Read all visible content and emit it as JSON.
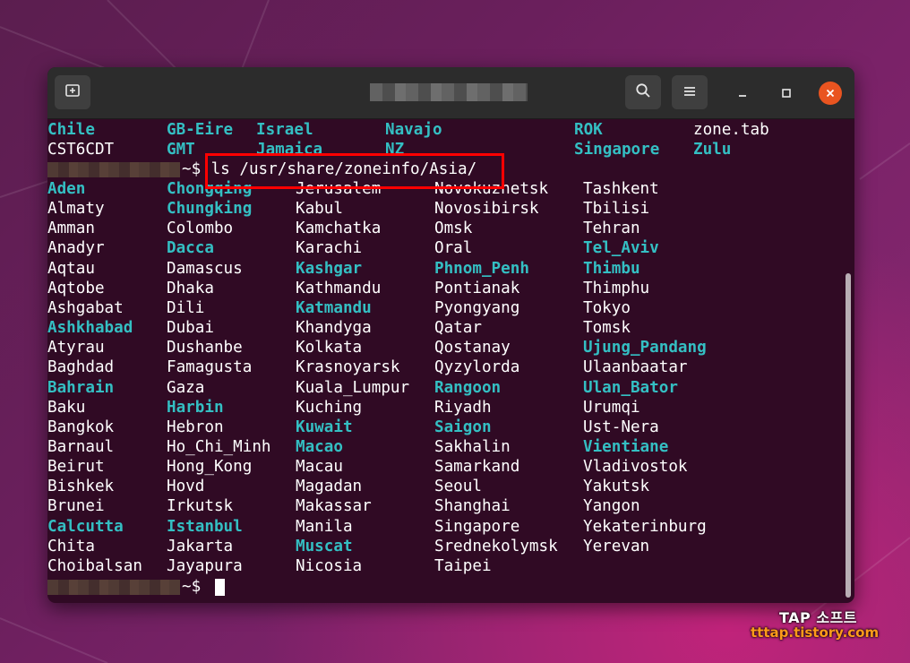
{
  "window": {
    "title_redacted": true,
    "buttons": {
      "new_tab": "new-tab",
      "search": "search",
      "menu": "menu",
      "minimize": "–",
      "maximize": "□",
      "close": "×"
    }
  },
  "colors": {
    "dir": "#34bfc3",
    "file": "#ffffff",
    "bg": "#300a24",
    "close": "#e95420",
    "highlight": "#ff0000",
    "watermark_url": "#ff9b1a"
  },
  "terminal": {
    "top_partial": [
      [
        [
          "Chile",
          "dir"
        ],
        [
          "GB-Eire",
          "dir"
        ],
        [
          "Israel",
          "dir"
        ],
        [
          "Navajo",
          "dir"
        ],
        [
          "ROK",
          "dir"
        ],
        [
          "zone.tab",
          "file"
        ]
      ],
      [
        [
          "CST6CDT",
          "file"
        ],
        [
          "GMT",
          "dir"
        ],
        [
          "Jamaica",
          "dir"
        ],
        [
          "NZ",
          "dir"
        ],
        [
          "Singapore",
          "dir"
        ],
        [
          "Zulu",
          "dir"
        ]
      ]
    ],
    "prompt_suffix": "~$",
    "command": " ls /usr/share/zoneinfo/Asia/",
    "listing": [
      [
        [
          "Aden",
          "dir"
        ],
        [
          "Chongqing",
          "dir"
        ],
        [
          "Jerusalem",
          "file"
        ],
        [
          "Novokuznetsk",
          "file"
        ],
        [
          "Tashkent",
          "file"
        ]
      ],
      [
        [
          "Almaty",
          "file"
        ],
        [
          "Chungking",
          "dir"
        ],
        [
          "Kabul",
          "file"
        ],
        [
          "Novosibirsk",
          "file"
        ],
        [
          "Tbilisi",
          "file"
        ]
      ],
      [
        [
          "Amman",
          "file"
        ],
        [
          "Colombo",
          "file"
        ],
        [
          "Kamchatka",
          "file"
        ],
        [
          "Omsk",
          "file"
        ],
        [
          "Tehran",
          "file"
        ]
      ],
      [
        [
          "Anadyr",
          "file"
        ],
        [
          "Dacca",
          "dir"
        ],
        [
          "Karachi",
          "file"
        ],
        [
          "Oral",
          "file"
        ],
        [
          "Tel_Aviv",
          "dir"
        ]
      ],
      [
        [
          "Aqtau",
          "file"
        ],
        [
          "Damascus",
          "file"
        ],
        [
          "Kashgar",
          "dir"
        ],
        [
          "Phnom_Penh",
          "dir"
        ],
        [
          "Thimbu",
          "dir"
        ]
      ],
      [
        [
          "Aqtobe",
          "file"
        ],
        [
          "Dhaka",
          "file"
        ],
        [
          "Kathmandu",
          "file"
        ],
        [
          "Pontianak",
          "file"
        ],
        [
          "Thimphu",
          "file"
        ]
      ],
      [
        [
          "Ashgabat",
          "file"
        ],
        [
          "Dili",
          "file"
        ],
        [
          "Katmandu",
          "dir"
        ],
        [
          "Pyongyang",
          "file"
        ],
        [
          "Tokyo",
          "file"
        ]
      ],
      [
        [
          "Ashkhabad",
          "dir"
        ],
        [
          "Dubai",
          "file"
        ],
        [
          "Khandyga",
          "file"
        ],
        [
          "Qatar",
          "file"
        ],
        [
          "Tomsk",
          "file"
        ]
      ],
      [
        [
          "Atyrau",
          "file"
        ],
        [
          "Dushanbe",
          "file"
        ],
        [
          "Kolkata",
          "file"
        ],
        [
          "Qostanay",
          "file"
        ],
        [
          "Ujung_Pandang",
          "dir"
        ]
      ],
      [
        [
          "Baghdad",
          "file"
        ],
        [
          "Famagusta",
          "file"
        ],
        [
          "Krasnoyarsk",
          "file"
        ],
        [
          "Qyzylorda",
          "file"
        ],
        [
          "Ulaanbaatar",
          "file"
        ]
      ],
      [
        [
          "Bahrain",
          "dir"
        ],
        [
          "Gaza",
          "file"
        ],
        [
          "Kuala_Lumpur",
          "file"
        ],
        [
          "Rangoon",
          "dir"
        ],
        [
          "Ulan_Bator",
          "dir"
        ]
      ],
      [
        [
          "Baku",
          "file"
        ],
        [
          "Harbin",
          "dir"
        ],
        [
          "Kuching",
          "file"
        ],
        [
          "Riyadh",
          "file"
        ],
        [
          "Urumqi",
          "file"
        ]
      ],
      [
        [
          "Bangkok",
          "file"
        ],
        [
          "Hebron",
          "file"
        ],
        [
          "Kuwait",
          "dir"
        ],
        [
          "Saigon",
          "dir"
        ],
        [
          "Ust-Nera",
          "file"
        ]
      ],
      [
        [
          "Barnaul",
          "file"
        ],
        [
          "Ho_Chi_Minh",
          "file"
        ],
        [
          "Macao",
          "dir"
        ],
        [
          "Sakhalin",
          "file"
        ],
        [
          "Vientiane",
          "dir"
        ]
      ],
      [
        [
          "Beirut",
          "file"
        ],
        [
          "Hong_Kong",
          "file"
        ],
        [
          "Macau",
          "file"
        ],
        [
          "Samarkand",
          "file"
        ],
        [
          "Vladivostok",
          "file"
        ]
      ],
      [
        [
          "Bishkek",
          "file"
        ],
        [
          "Hovd",
          "file"
        ],
        [
          "Magadan",
          "file"
        ],
        [
          "Seoul",
          "file"
        ],
        [
          "Yakutsk",
          "file"
        ]
      ],
      [
        [
          "Brunei",
          "file"
        ],
        [
          "Irkutsk",
          "file"
        ],
        [
          "Makassar",
          "file"
        ],
        [
          "Shanghai",
          "file"
        ],
        [
          "Yangon",
          "file"
        ]
      ],
      [
        [
          "Calcutta",
          "dir"
        ],
        [
          "Istanbul",
          "dir"
        ],
        [
          "Manila",
          "file"
        ],
        [
          "Singapore",
          "file"
        ],
        [
          "Yekaterinburg",
          "file"
        ]
      ],
      [
        [
          "Chita",
          "file"
        ],
        [
          "Jakarta",
          "file"
        ],
        [
          "Muscat",
          "dir"
        ],
        [
          "Srednekolymsk",
          "file"
        ],
        [
          "Yerevan",
          "file"
        ]
      ],
      [
        [
          "Choibalsan",
          "file"
        ],
        [
          "Jayapura",
          "file"
        ],
        [
          "Nicosia",
          "file"
        ],
        [
          "Taipei",
          "file"
        ],
        [
          "",
          ""
        ]
      ]
    ],
    "final_prompt": "~$"
  },
  "watermark": {
    "brand": "TAP 소프트",
    "url": "tttap.tistory.com"
  }
}
